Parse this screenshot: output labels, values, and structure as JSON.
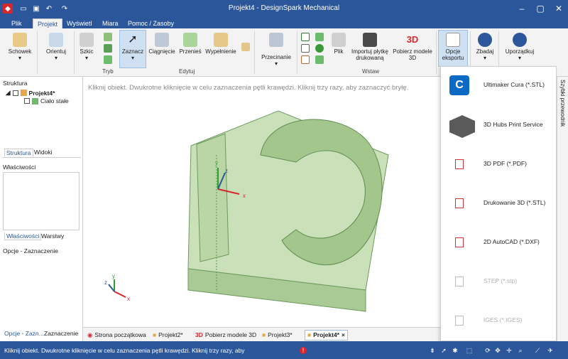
{
  "app": {
    "title": "Projekt4 - DesignSpark Mechanical"
  },
  "menu": [
    {
      "label": "Plik"
    },
    {
      "label": "Projekt"
    },
    {
      "label": "Wyświetl"
    },
    {
      "label": "Miara"
    },
    {
      "label": "Pomoc / Zasoby"
    }
  ],
  "ribbon": {
    "schowek": "Schowek",
    "orientuj": "Orientuj",
    "szkic": "Szkic",
    "tryb": "Tryb",
    "zaznacz": "Zaznacz",
    "ciagniecie": "Ciągnięcie",
    "przenies": "Przenieś",
    "wypelnienie": "Wypełnienie",
    "edytuj_group": "Edytuj",
    "przecinanie": "Przecinanie",
    "plik": "Plik",
    "importuj1": "Importuj płytkę",
    "importuj2": "drukowaną",
    "pobierz1": "Pobierz modele",
    "pobierz2": "3D",
    "wstaw_group": "Wstaw",
    "opcje1": "Opcje",
    "opcje2": "eksportu",
    "zbadaj": "Zbadaj",
    "uporzadkuj": "Uporządkuj"
  },
  "left_panel": {
    "structure_title": "Struktura",
    "project": "Projekt4*",
    "body": "Ciało stałe",
    "tab_struktura": "Struktura",
    "tab_widoki": "Widoki",
    "properties_title": "Właściwości",
    "tab_wlasciwosci": "Właściwości",
    "tab_warstwy": "Warstwy",
    "options_title": "Opcje - Zaznaczenie",
    "tab_opcje": "Opcje - Zazn...",
    "tab_zaznaczenie": "Zaznaczenie"
  },
  "canvas": {
    "hint": "Kliknij obiekt. Dwukrotne kliknięcie w celu zaznaczenia pętli krawędzi. Kliknij trzy razy, aby zaznaczyć bryłę."
  },
  "doc_tabs": [
    {
      "label": "Strona początkowa"
    },
    {
      "label": "Projekt2*"
    },
    {
      "label": "Pobierz modele 3D"
    },
    {
      "label": "Projekt3*"
    },
    {
      "label": "Projekt4*"
    }
  ],
  "export_menu": [
    {
      "label": "Ultimaker Cura (*.STL)",
      "enabled": true
    },
    {
      "label": "3D Hubs Print Service",
      "enabled": true
    },
    {
      "label": "3D PDF (*.PDF)",
      "enabled": true
    },
    {
      "label": "Drukowanie 3D (*.STL)",
      "enabled": true
    },
    {
      "label": "2D AutoCAD (*.DXF)",
      "enabled": true
    },
    {
      "label": "STEP (*.stp)",
      "enabled": false
    },
    {
      "label": "IGES (*.IGES)",
      "enabled": false
    }
  ],
  "right_side": {
    "label": "Szybki przewodnik"
  },
  "status": {
    "text": "Kliknij obiekt. Dwukrotne kliknięcie w celu zaznaczenia pętli krawędzi. Kliknij trzy razy, aby"
  },
  "axes": {
    "x": "x",
    "y": "y",
    "z": "z"
  }
}
